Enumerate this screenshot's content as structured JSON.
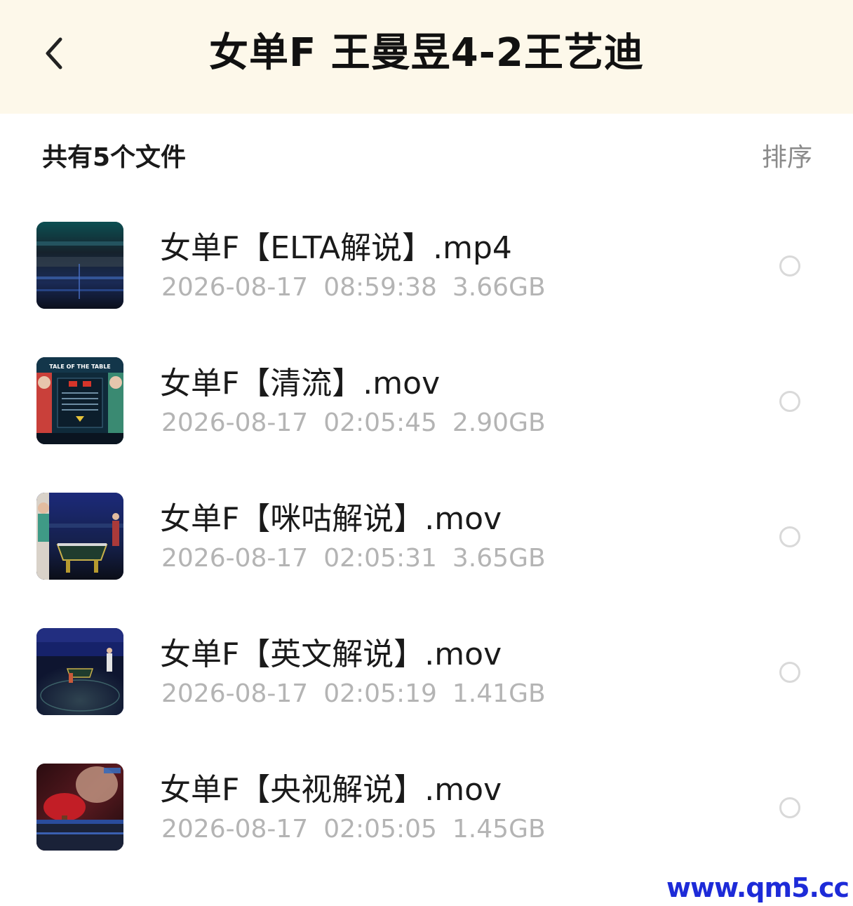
{
  "header": {
    "back_icon": "chevron-left-icon",
    "title": "女单F 王曼昱4-2王艺迪"
  },
  "summary": {
    "file_count_text": "共有5个文件",
    "sort_label": "排序"
  },
  "files": [
    {
      "name": "女单F【ELTA解说】.mp4",
      "date": "2026-08-17",
      "time": "08:59:38",
      "size": "3.66GB"
    },
    {
      "name": "女单F【清流】.mov",
      "date": "2026-08-17",
      "time": "02:05:45",
      "size": "2.90GB",
      "thumb_text": "TALE OF THE TABLE"
    },
    {
      "name": "女单F【咪咕解说】.mov",
      "date": "2026-08-17",
      "time": "02:05:31",
      "size": "3.65GB"
    },
    {
      "name": "女单F【英文解说】.mov",
      "date": "2026-08-17",
      "time": "02:05:19",
      "size": "1.41GB"
    },
    {
      "name": "女单F【央视解说】.mov",
      "date": "2026-08-17",
      "time": "02:05:05",
      "size": "1.45GB"
    }
  ],
  "watermark": "www.qm5.cc",
  "colors": {
    "header_bg": "#fdf8ea",
    "meta_text": "#b4b4b4",
    "sort_text": "#8a8a8a",
    "watermark": "#1d2bd8"
  }
}
